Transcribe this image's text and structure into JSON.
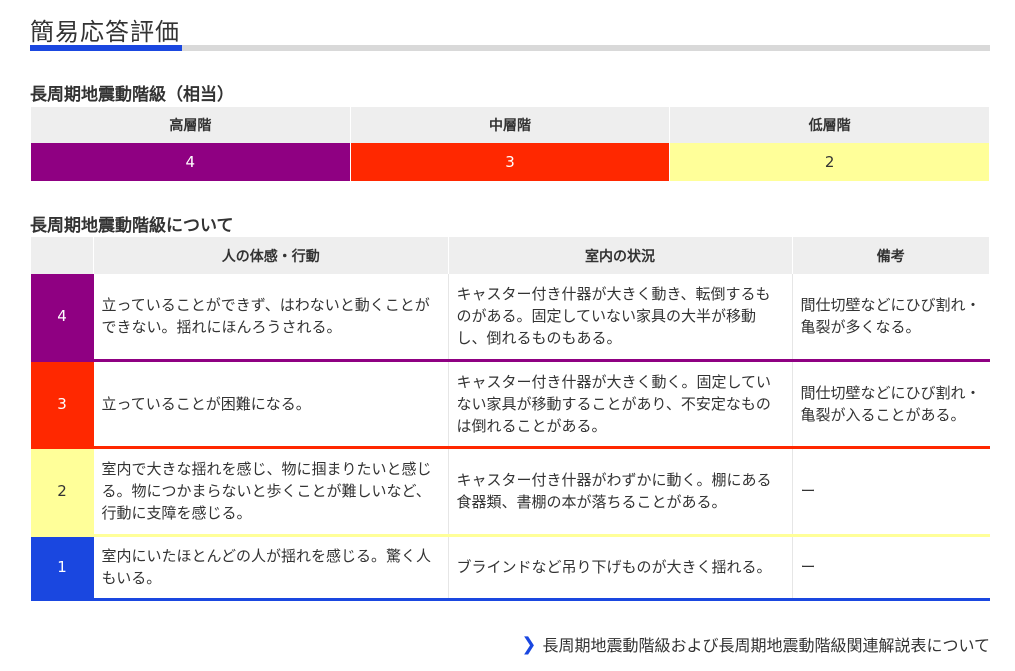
{
  "title": "簡易応答評価",
  "colors": {
    "accent": "#1a47e0",
    "level4": "#8f0082",
    "level3": "#ff2800",
    "level2": "#ffff99",
    "level1": "#1a47e0"
  },
  "equivalent": {
    "heading": "長周期地震動階級（相当）",
    "headers": [
      "高層階",
      "中層階",
      "低層階"
    ],
    "values": [
      "4",
      "3",
      "2"
    ]
  },
  "about": {
    "heading": "長周期地震動階級について",
    "headers": [
      "",
      "人の体感・行動",
      "室内の状況",
      "備考"
    ],
    "rows": [
      {
        "level": "4",
        "body": "立っていることができず、はわないと動くことができない。揺れにほんろうされる。",
        "room": "キャスター付き什器が大きく動き、転倒するものがある。固定していない家具の大半が移動し、倒れるものもある。",
        "note": "間仕切壁などにひび割れ・亀裂が多くなる。"
      },
      {
        "level": "3",
        "body": "立っていることが困難になる。",
        "room": "キャスター付き什器が大きく動く。固定していない家具が移動することがあり、不安定なものは倒れることがある。",
        "note": "間仕切壁などにひび割れ・亀裂が入ることがある。"
      },
      {
        "level": "2",
        "body": "室内で大きな揺れを感じ、物に掴まりたいと感じる。物につかまらないと歩くことが難しいなど、行動に支障を感じる。",
        "room": "キャスター付き什器がわずかに動く。棚にある食器類、書棚の本が落ちることがある。",
        "note": "ー"
      },
      {
        "level": "1",
        "body": "室内にいたほとんどの人が揺れを感じる。驚く人もいる。",
        "room": "ブラインドなど吊り下げものが大きく揺れる。",
        "note": "ー"
      }
    ]
  },
  "footer_link": "長周期地震動階級および長周期地震動階級関連解説表について"
}
